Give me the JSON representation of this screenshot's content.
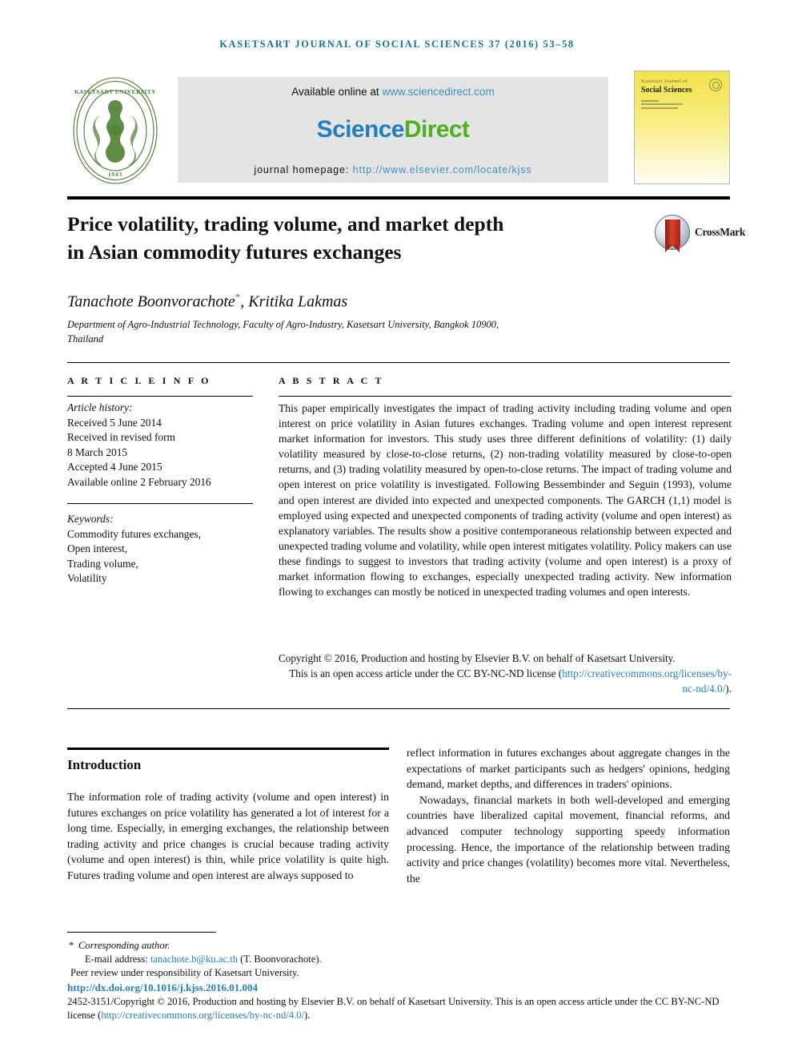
{
  "running_head": "Kasetsart Journal of Social Sciences 37 (2016) 53–58",
  "masthead": {
    "seal_alt": "kasetsart-university-seal",
    "seal_year": "1943",
    "seal_ring_text": "KASETSART UNIVERSITY",
    "available_prefix": "Available online at ",
    "available_link": "www.sciencedirect.com",
    "wordmark_science": "Science",
    "wordmark_direct": "Direct",
    "homepage_prefix": "journal homepage: ",
    "homepage_link": "http://www.elsevier.com/locate/kjss",
    "cover": {
      "line_small": "Kasetsart Journal of",
      "line_large": "Social Sciences"
    }
  },
  "article": {
    "title_line1": "Price volatility, trading volume, and market depth",
    "title_line2": "in Asian commodity futures exchanges",
    "crossmark_label": "CrossMark",
    "authors": "Tanachote Boonvorachote",
    "authors_rest": ", Kritika Lakmas",
    "corresponding_marker": "*",
    "affiliation_line1": "Department of Agro-Industrial Technology, Faculty of Agro-Industry, Kasetsart University, Bangkok 10900,",
    "affiliation_line2": "Thailand"
  },
  "info": {
    "heading": "A R T I C L E   I N F O",
    "history_label": "Article history:",
    "received": "Received 5 June 2014",
    "revised_label": "Received in revised form",
    "revised_date": "8 March 2015",
    "accepted": "Accepted 4 June 2015",
    "available_online": "Available online 2 February 2016",
    "keywords_label": "Keywords:",
    "keywords": [
      "Commodity futures exchanges,",
      "Open interest,",
      "Trading volume,",
      "Volatility"
    ]
  },
  "abstract": {
    "heading": "A B S T R A C T",
    "body": "This paper empirically investigates the impact of trading activity including trading volume and open interest on price volatility in Asian futures exchanges. Trading volume and open interest represent market information for investors. This study uses three different definitions of volatility: (1) daily volatility measured by close-to-close returns, (2) non-trading volatility measured by close-to-open returns, and (3) trading volatility measured by open-to-close returns. The impact of trading volume and open interest on price volatility is investigated. Following Bessembinder and Seguin (1993), volume and open interest are divided into expected and unexpected components. The GARCH (1,1) model is employed using expected and unexpected components of trading activity (volume and open interest) as explanatory variables. The results show a positive contemporaneous relationship between expected and unexpected trading volume and volatility, while open interest mitigates volatility. Policy makers can use these findings to suggest to investors that trading activity (volume and open interest) is a proxy of market information flowing to exchanges, especially unexpected trading activity. New information flowing to exchanges can mostly be noticed in unexpected trading volumes and open interests.",
    "copyright_line1": "Copyright © 2016, Production and hosting by Elsevier B.V. on behalf of Kasetsart University.",
    "copyright_line2": "This is an open access article under the CC BY-NC-ND license (",
    "copyright_link": "http://creativecommons.org/licenses/by-nc-nd/4.0/",
    "copyright_tail": ")."
  },
  "body": {
    "section_heading": "Introduction",
    "left_paragraph": "The information role of trading activity (volume and open interest) in futures exchanges on price volatility has generated a lot of interest for a long time. Especially, in emerging exchanges, the relationship between trading activity and price changes is crucial because trading activity (volume and open interest) is thin, while price volatility is quite high. Futures trading volume and open interest are always supposed to",
    "right_paragraph_1": "reflect information in futures exchanges about aggregate changes in the expectations of market participants such as hedgers' opinions, hedging demand, market depths, and differences in traders' opinions.",
    "right_paragraph_2": "Nowadays, financial markets in both well-developed and emerging countries have liberalized capital movement, financial reforms, and advanced computer technology supporting speedy information processing. Hence, the importance of the relationship between trading activity and price changes (volatility) becomes more vital. Nevertheless, the"
  },
  "footnotes": {
    "corresponding_star": "*",
    "corresponding_text": "Corresponding author.",
    "email_label": "E-mail address: ",
    "email_link": "tanachote.b@ku.ac.th",
    "email_tail": " (T. Boonvorachote).",
    "peer_review": "Peer review under responsibility of Kasetsart University.",
    "doi": "http://dx.doi.org/10.1016/j.kjss.2016.01.004",
    "bottom_copyright_pre": "2452-3151/Copyright © 2016, Production and hosting by Elsevier B.V. on behalf of Kasetsart University. This is an open access article under the CC BY-NC-ND license (",
    "bottom_copyright_link": "http://creativecommons.org/licenses/by-nc-nd/4.0/",
    "bottom_copyright_post": ")."
  },
  "colors": {
    "running_head": "#0d72a8",
    "link": "#1f7ec4",
    "science": "#1f7ec4",
    "direct": "#4caf1f",
    "seal_green": "#4a7c2f",
    "cover_yellow": "#f3e14d"
  }
}
